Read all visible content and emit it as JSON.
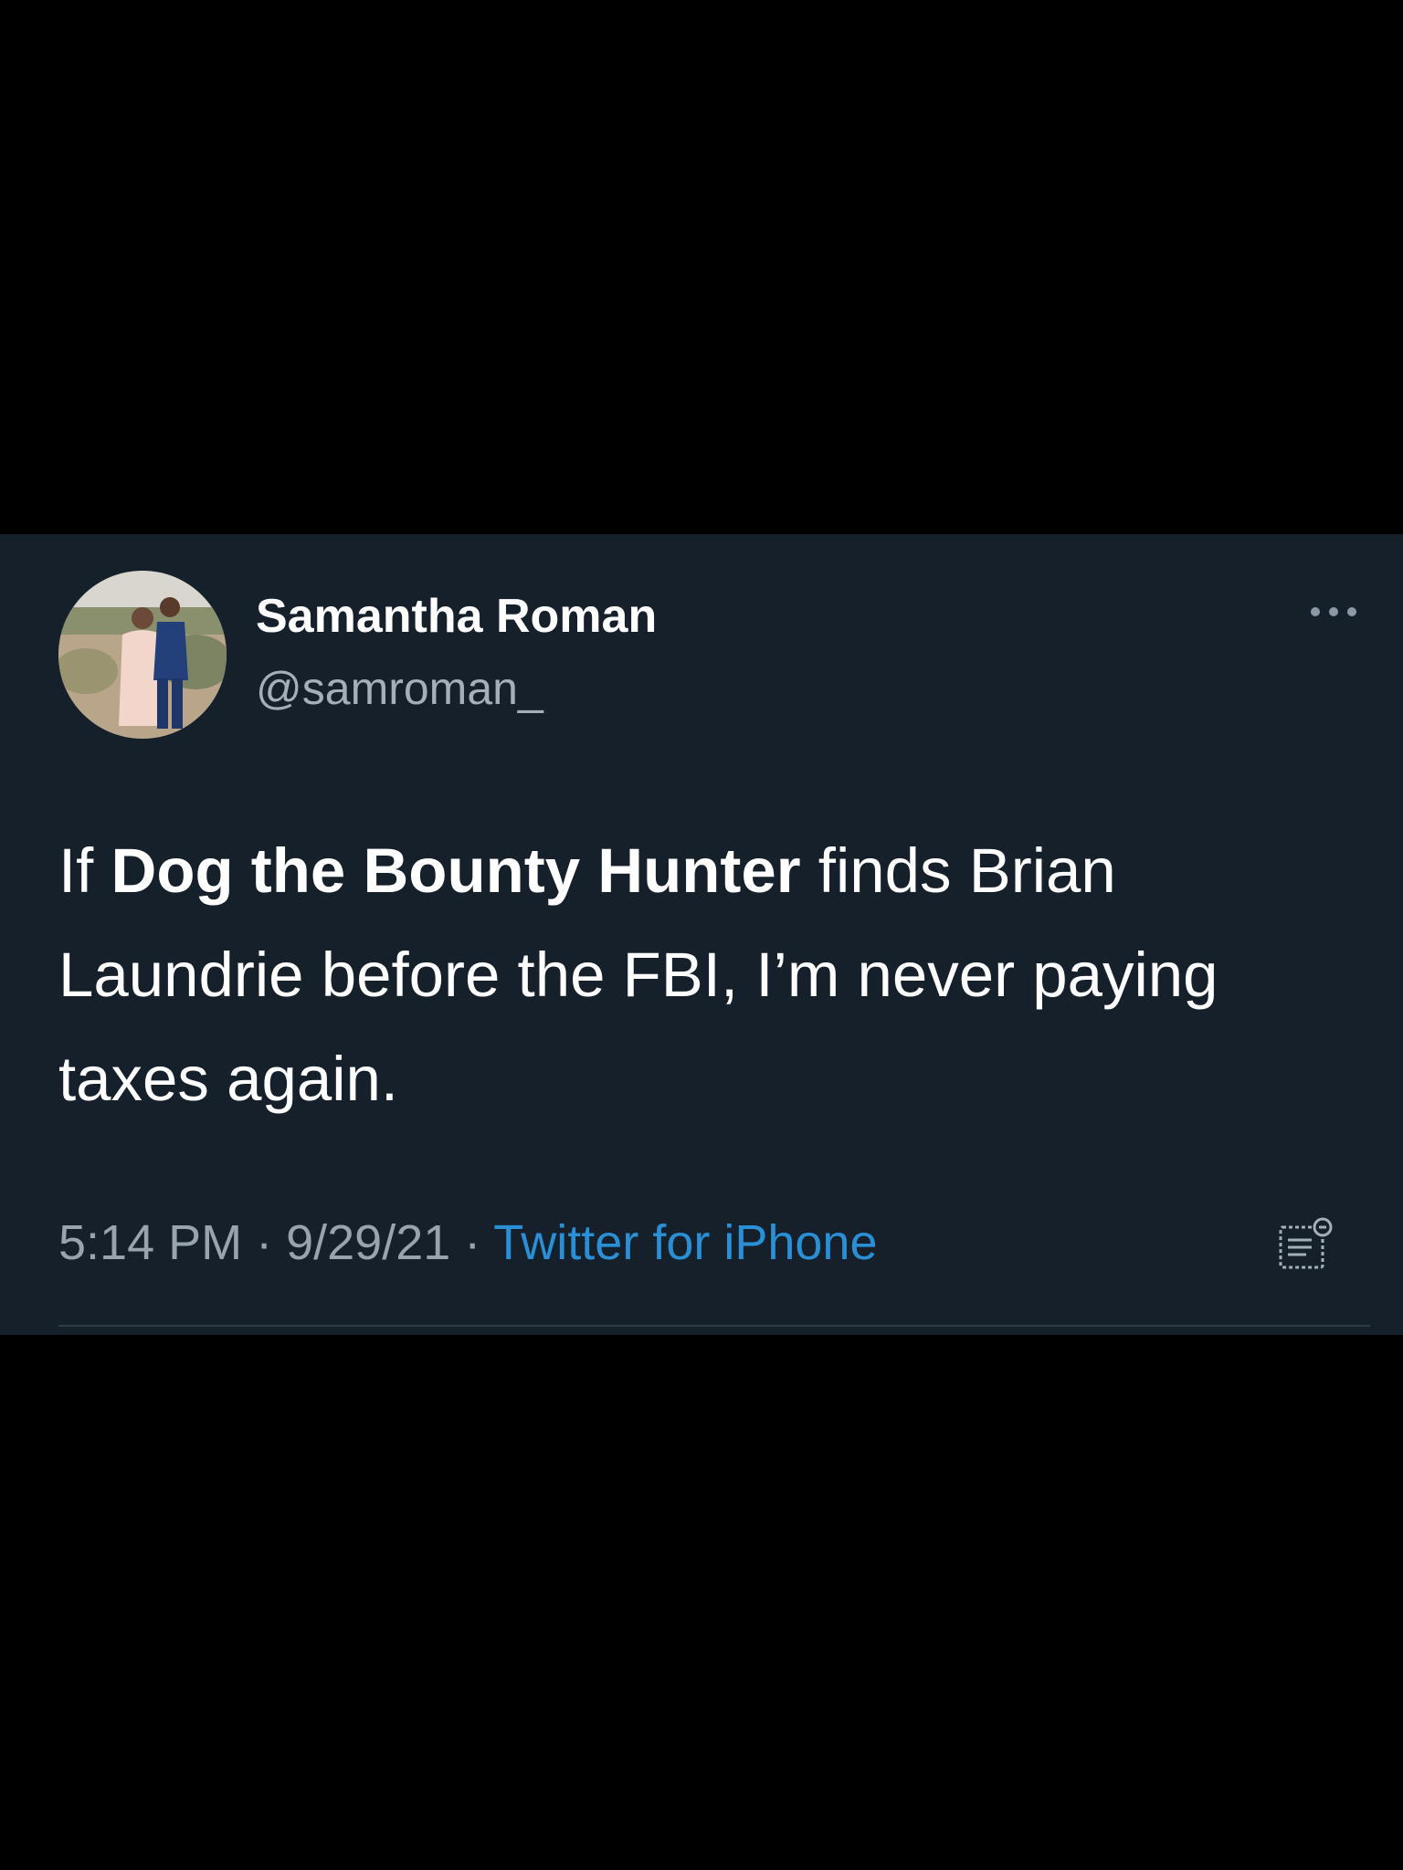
{
  "tweet": {
    "author": {
      "display_name": "Samantha Roman",
      "handle": "@samroman_"
    },
    "text": {
      "prefix": "If ",
      "bold": "Dog the Bounty Hunter",
      "suffix": " finds Brian Laundrie before the FBI, I’m never paying taxes again."
    },
    "meta": {
      "time": "5:14 PM",
      "separator": " · ",
      "date": "9/29/21",
      "source": "Twitter for iPhone"
    },
    "icons": {
      "more": "more-options-icon",
      "analytics": "analytics-icon"
    }
  },
  "colors": {
    "card_background": "#15202b",
    "page_background": "#000000",
    "text": "#ffffff",
    "secondary_text": "#a4afb9",
    "link": "#2b8fd6",
    "divider": "#2f3b47"
  }
}
